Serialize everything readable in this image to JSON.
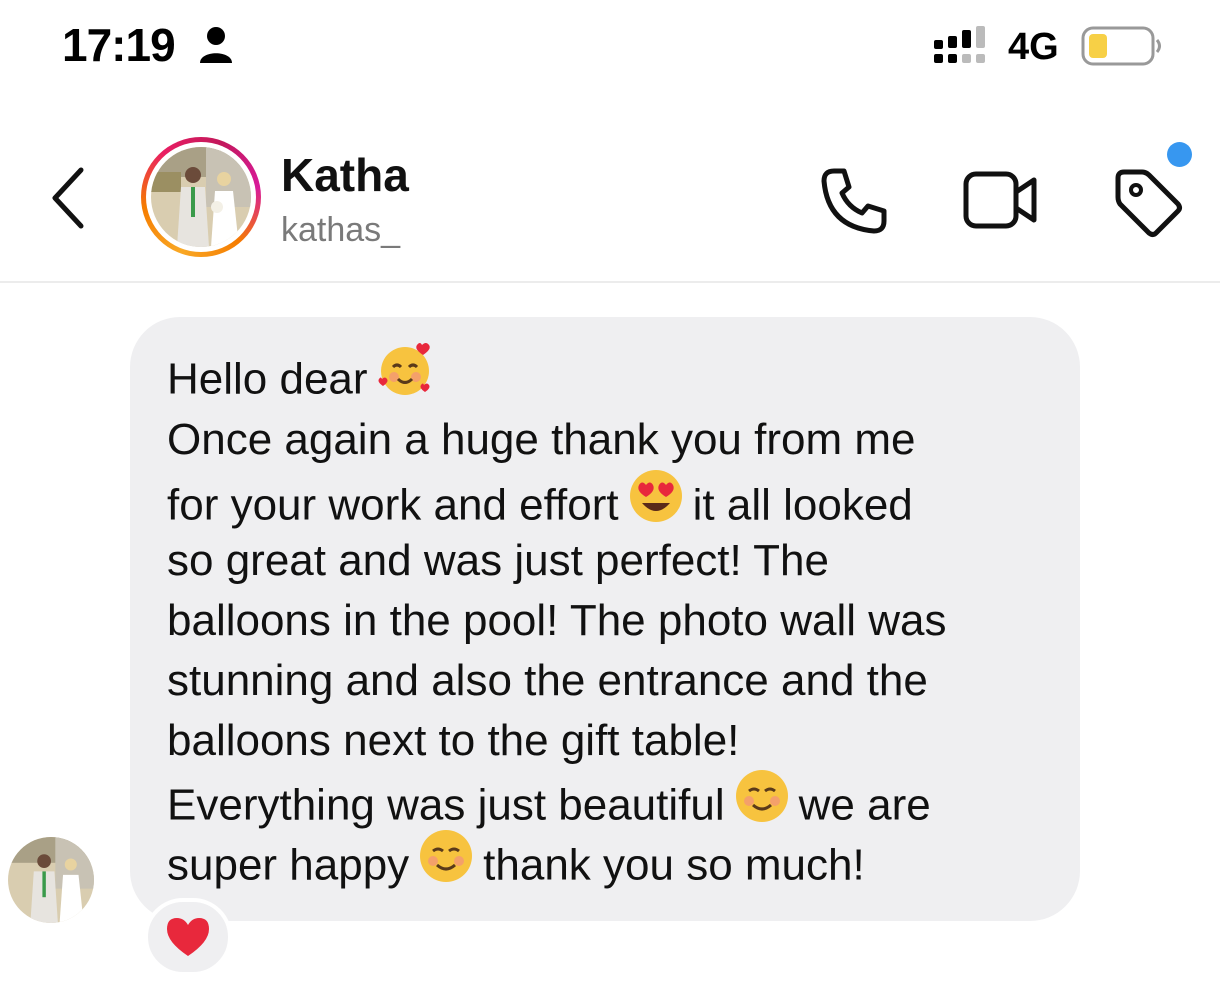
{
  "status_bar": {
    "time": "17:19",
    "network": "4G",
    "icons": [
      "person-icon",
      "signal-icon",
      "battery-icon"
    ],
    "battery_color": "#f7d046"
  },
  "header": {
    "contact_name": "Katha",
    "username": "kathas_",
    "icons": [
      "back-chevron-icon",
      "phone-icon",
      "video-camera-icon",
      "tag-icon"
    ],
    "notification_dot_color": "#3797f0",
    "story_ring_colors": [
      "#f9a825",
      "#e91e63",
      "#d81b9a"
    ]
  },
  "message": {
    "lines": [
      "Hello dear",
      "Once again a huge thank you from me",
      "for your work and effort",
      "it all looked",
      "so great and was just perfect! The",
      "balloons in the pool! The photo wall was",
      "stunning and also the entrance and the",
      "balloons next to the gift table!",
      "Everything was just beautiful",
      "we are",
      "super happy",
      "thank you so much!"
    ],
    "emojis": [
      "smiling-face-with-hearts-emoji",
      "heart-eyes-emoji",
      "smiling-face-emoji",
      "smiling-face-emoji"
    ],
    "reaction": "heart-reaction-icon",
    "bubble_color": "#efeff1"
  }
}
